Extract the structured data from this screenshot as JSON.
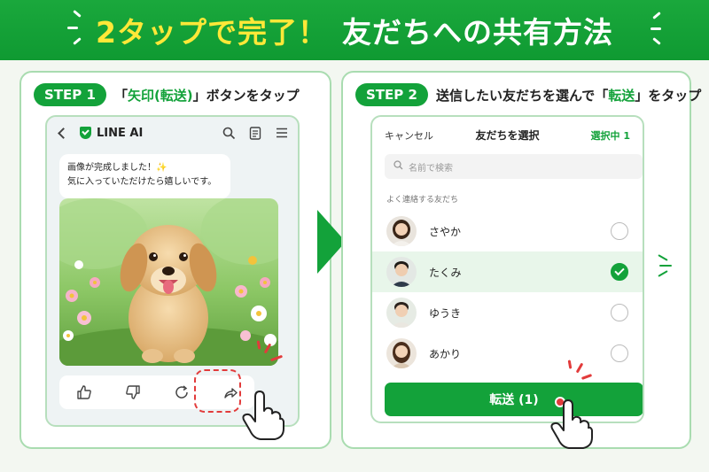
{
  "banner": {
    "title_part1": "2タップで完了！",
    "title_part2": "友だちへの共有方法"
  },
  "step1": {
    "badge": "STEP 1",
    "text_pre": "「",
    "text_highlight": "矢印(転送)",
    "text_post": "」ボタンをタップ",
    "app_title": "LINE AI",
    "message_line1": "画像が完成しました！✨",
    "message_line2": "気に入っていただけたら嬉しいです。",
    "icons": [
      "back-icon",
      "shield-icon",
      "search-icon",
      "note-icon",
      "menu-icon",
      "thumbs-up-icon",
      "thumbs-down-icon",
      "refresh-icon",
      "share-arrow-icon"
    ]
  },
  "step2": {
    "badge": "STEP 2",
    "text_pre": "送信したい友だちを選んで「",
    "text_highlight": "転送",
    "text_post": "」をタップ",
    "cancel": "キャンセル",
    "title": "友だちを選択",
    "selected_count": "選択中 1",
    "search_placeholder": "名前で検索",
    "section_label": "よく連絡する友だち",
    "friends": [
      {
        "name": "さやか",
        "selected": false
      },
      {
        "name": "たくみ",
        "selected": true
      },
      {
        "name": "ゆうき",
        "selected": false
      },
      {
        "name": "あかり",
        "selected": false
      }
    ],
    "send_button": "転送 (1)"
  },
  "colors": {
    "brand_green": "#13a23a",
    "banner_yellow": "#ffe838",
    "highlight_red": "#e23b3b"
  }
}
